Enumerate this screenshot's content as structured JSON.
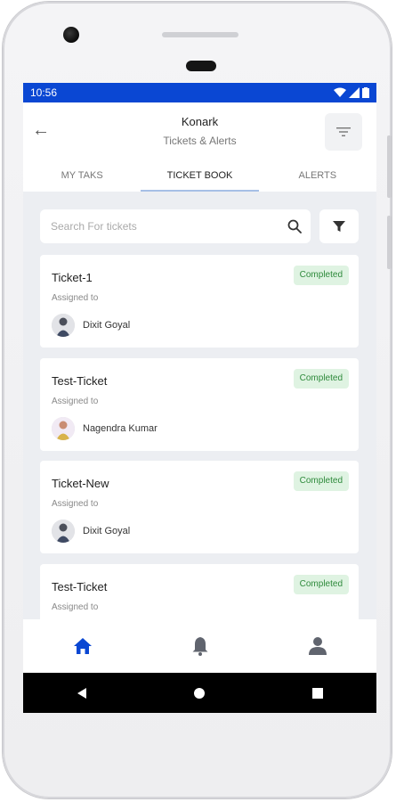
{
  "status": {
    "time": "10:56"
  },
  "header": {
    "title": "Konark",
    "subtitle": "Tickets & Alerts"
  },
  "tabs": [
    {
      "label": "MY TAKS"
    },
    {
      "label": "TICKET BOOK",
      "active": true
    },
    {
      "label": "ALERTS"
    }
  ],
  "search": {
    "placeholder": "Search For tickets"
  },
  "tickets": [
    {
      "title": "Ticket-1",
      "status": "Completed",
      "assigned_label": "Assigned to",
      "assignee": "Dixit Goyal"
    },
    {
      "title": "Test-Ticket",
      "status": "Completed",
      "assigned_label": "Assigned to",
      "assignee": "Nagendra Kumar"
    },
    {
      "title": "Ticket-New",
      "status": "Completed",
      "assigned_label": "Assigned to",
      "assignee": "Dixit Goyal"
    },
    {
      "title": "Test-Ticket",
      "status": "Completed",
      "assigned_label": "Assigned to",
      "assignee": ""
    }
  ],
  "nav": {
    "active": "home"
  },
  "colors": {
    "statusbar": "#0a47d3",
    "accent": "#0a47d3",
    "badge_bg": "#dff3e2",
    "badge_text": "#2e8a3b"
  }
}
